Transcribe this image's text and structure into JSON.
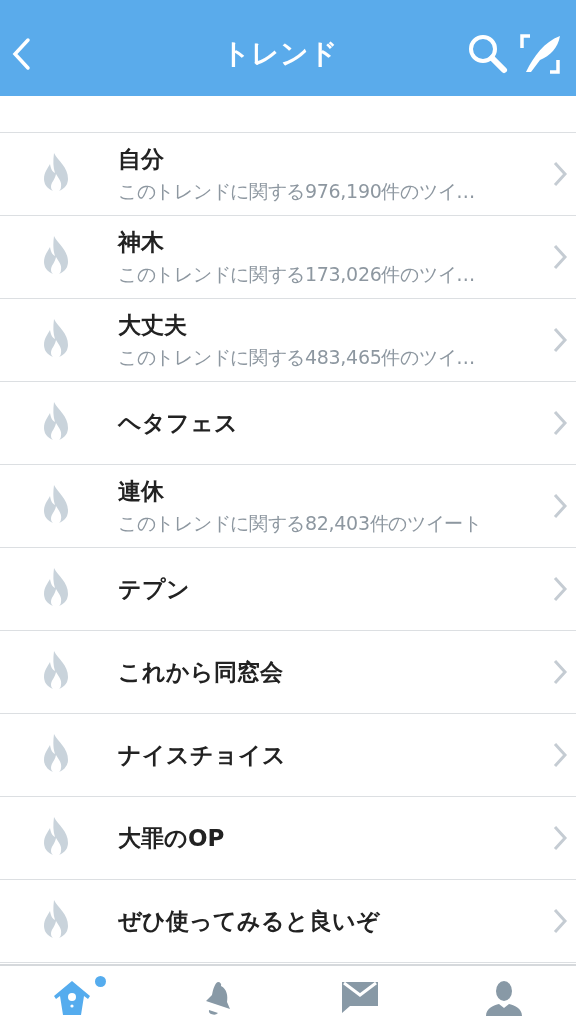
{
  "header": {
    "title": "トレンド"
  },
  "trends": [
    {
      "name": "自分",
      "detail": "このトレンドに関する976,190件のツイ…"
    },
    {
      "name": "神木",
      "detail": "このトレンドに関する173,026件のツイ…"
    },
    {
      "name": "大丈夫",
      "detail": "このトレンドに関する483,465件のツイ…"
    },
    {
      "name": "ヘタフェス"
    },
    {
      "name": "連休",
      "detail": "このトレンドに関する82,403件のツイート"
    },
    {
      "name": "テプン"
    },
    {
      "name": "これから同窓会"
    },
    {
      "name": "ナイスチョイス"
    },
    {
      "name": "大罪のOP"
    },
    {
      "name": "ぜひ使ってみると良いぞ"
    }
  ],
  "tab_bar": [
    {
      "kind": "home",
      "selected": true,
      "dot": true
    },
    {
      "kind": "notifications",
      "selected": false,
      "dot": false
    },
    {
      "kind": "messages",
      "selected": false,
      "dot": false
    },
    {
      "kind": "profile",
      "selected": false,
      "dot": false
    }
  ]
}
